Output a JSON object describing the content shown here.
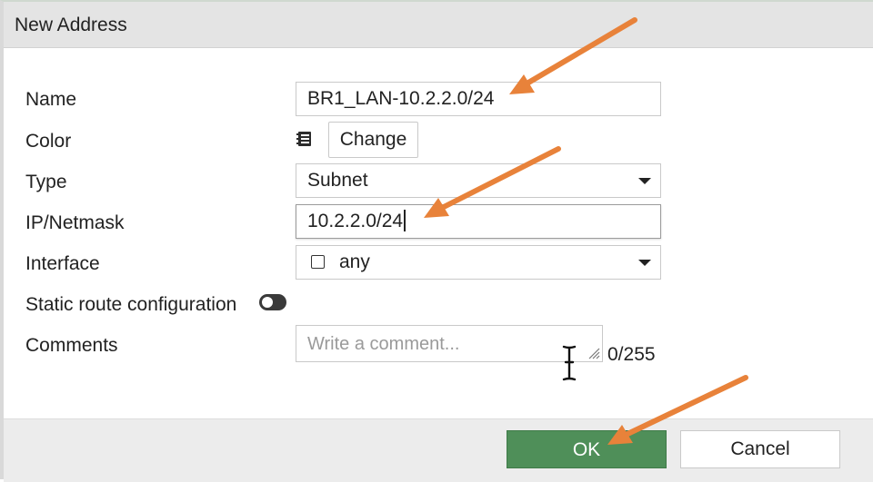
{
  "dialog": {
    "title": "New Address"
  },
  "form": {
    "name": {
      "label": "Name",
      "value": "BR1_LAN-10.2.2.0/24"
    },
    "color": {
      "label": "Color",
      "change_label": "Change"
    },
    "type": {
      "label": "Type",
      "value": "Subnet"
    },
    "ip_netmask": {
      "label": "IP/Netmask",
      "value": "10.2.2.0/24"
    },
    "interface": {
      "label": "Interface",
      "value": "any"
    },
    "static_route": {
      "label": "Static route configuration",
      "enabled": false
    },
    "comments": {
      "label": "Comments",
      "placeholder": "Write a comment...",
      "count": "0/255"
    }
  },
  "footer": {
    "ok_label": "OK",
    "cancel_label": "Cancel"
  },
  "colors": {
    "ok_button": "#4f8f59",
    "annotation_arrow": "#e8823a",
    "toggle": "#3a3a3a"
  },
  "icons": {
    "color": "color-swatch-icon",
    "dropdown": "chevron-down-icon",
    "resize": "resize-grip-icon",
    "cursor": "text-cursor-icon"
  }
}
